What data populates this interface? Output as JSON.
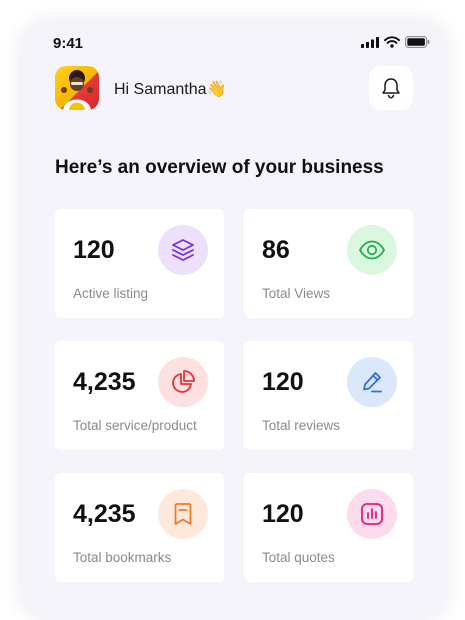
{
  "status_bar": {
    "time": "9:41",
    "icons": [
      "signal-icon",
      "wifi-icon",
      "battery-icon"
    ]
  },
  "header": {
    "greeting": "Hi Samantha👋",
    "notification_icon": "bell-icon"
  },
  "overview": {
    "title": "Here’s an overview of your business"
  },
  "stats": [
    {
      "value": "120",
      "label": "Active listing",
      "icon": "layers-icon",
      "icon_bg": "#ece0fb",
      "icon_color": "#7b2ee6"
    },
    {
      "value": "86",
      "label": "Total Views",
      "icon": "eye-icon",
      "icon_bg": "#dcf7e0",
      "icon_color": "#22b04b"
    },
    {
      "value": "4,235",
      "label": "Total service/product",
      "icon": "pie-chart-icon",
      "icon_bg": "#fde0e0",
      "icon_color": "#e8323a"
    },
    {
      "value": "120",
      "label": "Total reviews",
      "icon": "edit-icon",
      "icon_bg": "#dbe7fb",
      "icon_color": "#2f6fe4"
    },
    {
      "value": "4,235",
      "label": "Total bookmarks",
      "icon": "bookmark-icon",
      "icon_bg": "#fde9dc",
      "icon_color": "#ef7a2b"
    },
    {
      "value": "120",
      "label": "Total quotes",
      "icon": "bar-chart-icon",
      "icon_bg": "#fcdcec",
      "icon_color": "#e5197f"
    }
  ]
}
